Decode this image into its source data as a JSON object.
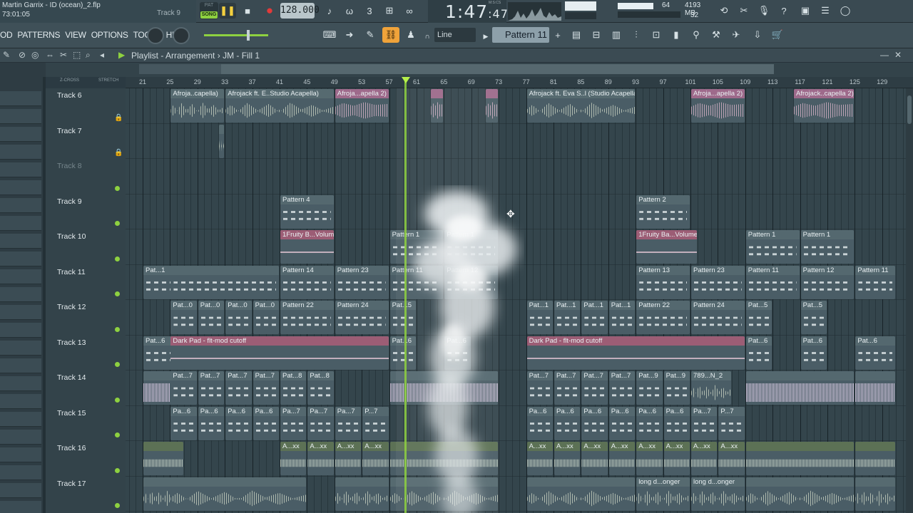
{
  "window": {
    "project_title": "Martin Garrix - ID (ocean)_2.flp",
    "project_time": "73:01:05",
    "track_hint": "Track 9"
  },
  "transport": {
    "pat_label": "PAT",
    "song_label": "SONG",
    "tempo": "128.000",
    "time": "1:47",
    "time_fraction": ":47",
    "time_units": "M:S:CS"
  },
  "system": {
    "cpu": "64",
    "memory": "4193 MB",
    "polyphony": "32"
  },
  "menu": [
    "OD",
    "PATTERNS",
    "VIEW",
    "OPTIONS",
    "TOOLS",
    "HELP"
  ],
  "toolbar": {
    "snap": "Line",
    "pattern": "Pattern 11"
  },
  "playlist": {
    "title": "Playlist - Arrangement",
    "arrangement": "JM - Fill 1",
    "zcross_label": "Z-CROSS",
    "stretch_label": "STRETCH"
  },
  "ruler_ticks": [
    "21",
    "25",
    "29",
    "33",
    "37",
    "41",
    "45",
    "49",
    "53",
    "57",
    "61",
    "65",
    "69",
    "73",
    "77",
    "81",
    "85",
    "89",
    "93",
    "97",
    "101",
    "105",
    "109",
    "113",
    "117",
    "121",
    "125",
    "129"
  ],
  "tracks": [
    {
      "name": "Track 6",
      "locked": true,
      "dim": false
    },
    {
      "name": "Track 7",
      "locked": true,
      "dim": false
    },
    {
      "name": "Track 8",
      "locked": false,
      "dim": true
    },
    {
      "name": "Track 9",
      "locked": false,
      "dim": false
    },
    {
      "name": "Track 10",
      "locked": false,
      "dim": false
    },
    {
      "name": "Track 11",
      "locked": false,
      "dim": false
    },
    {
      "name": "Track 12",
      "locked": false,
      "dim": false
    },
    {
      "name": "Track 13",
      "locked": false,
      "dim": false
    },
    {
      "name": "Track 14",
      "locked": false,
      "dim": false
    },
    {
      "name": "Track 15",
      "locked": false,
      "dim": false
    },
    {
      "name": "Track 16",
      "locked": false,
      "dim": false
    },
    {
      "name": "Track 17",
      "locked": false,
      "dim": false
    }
  ],
  "clips": [
    {
      "track": 0,
      "kind": "audio",
      "label": "Afroja..capella)",
      "start": 25,
      "end": 33
    },
    {
      "track": 0,
      "kind": "audio",
      "label": "Afrojack ft. E..Studio Acapella)",
      "start": 33,
      "end": 49
    },
    {
      "track": 0,
      "kind": "pink",
      "label": "Afroja...apella 2)",
      "start": 49,
      "end": 57
    },
    {
      "track": 0,
      "kind": "pink",
      "label": "",
      "start": 63,
      "end": 65
    },
    {
      "track": 0,
      "kind": "pink",
      "label": "",
      "start": 71,
      "end": 73
    },
    {
      "track": 0,
      "kind": "audio",
      "label": "Afrojack ft. Eva S..l (Studio Acapella)",
      "start": 77,
      "end": 93
    },
    {
      "track": 0,
      "kind": "pink",
      "label": "Afroja...apella 2)",
      "start": 101,
      "end": 109
    },
    {
      "track": 0,
      "kind": "pink",
      "label": "Afrojack..capella 2)",
      "start": 116,
      "end": 125
    },
    {
      "track": 1,
      "kind": "audio",
      "label": "",
      "start": 32,
      "end": 33
    },
    {
      "track": 3,
      "kind": "pattern",
      "label": "Pattern 4",
      "start": 41,
      "end": 49
    },
    {
      "track": 3,
      "kind": "pattern",
      "label": "Pattern 2",
      "start": 93,
      "end": 101
    },
    {
      "track": 4,
      "kind": "automation",
      "label": "1Fruity B...Volume",
      "start": 41,
      "end": 49
    },
    {
      "track": 4,
      "kind": "pattern",
      "label": "Pattern 1",
      "start": 57,
      "end": 65
    },
    {
      "track": 4,
      "kind": "pattern",
      "label": "Pattern 1",
      "start": 65,
      "end": 73
    },
    {
      "track": 4,
      "kind": "automation",
      "label": "1Fruity Ba...Volume",
      "start": 93,
      "end": 102
    },
    {
      "track": 4,
      "kind": "pattern",
      "label": "Pattern 1",
      "start": 109,
      "end": 117
    },
    {
      "track": 4,
      "kind": "pattern",
      "label": "Pattern 1",
      "start": 117,
      "end": 125
    },
    {
      "track": 5,
      "kind": "pattern",
      "label": "Pat...1",
      "start": 21,
      "end": 27
    },
    {
      "track": 5,
      "kind": "pattern",
      "label": "",
      "start": 25,
      "end": 41
    },
    {
      "track": 5,
      "kind": "pattern",
      "label": "Pattern 14",
      "start": 41,
      "end": 49
    },
    {
      "track": 5,
      "kind": "pattern",
      "label": "Pattern 23",
      "start": 49,
      "end": 57
    },
    {
      "track": 5,
      "kind": "pattern",
      "label": "Pattern 11",
      "start": 57,
      "end": 65
    },
    {
      "track": 5,
      "kind": "pattern",
      "label": "Pattern 12",
      "start": 65,
      "end": 73
    },
    {
      "track": 5,
      "kind": "pattern",
      "label": "Pattern 13",
      "start": 93,
      "end": 101
    },
    {
      "track": 5,
      "kind": "pattern",
      "label": "Pattern 23",
      "start": 101,
      "end": 109
    },
    {
      "track": 5,
      "kind": "pattern",
      "label": "Pattern 11",
      "start": 109,
      "end": 117
    },
    {
      "track": 5,
      "kind": "pattern",
      "label": "Pattern 12",
      "start": 117,
      "end": 125
    },
    {
      "track": 5,
      "kind": "pattern",
      "label": "Pattern 11",
      "start": 125,
      "end": 131
    },
    {
      "track": 6,
      "kind": "pattern",
      "label": "Pat...0",
      "start": 25,
      "end": 29
    },
    {
      "track": 6,
      "kind": "pattern",
      "label": "Pat...0",
      "start": 29,
      "end": 33
    },
    {
      "track": 6,
      "kind": "pattern",
      "label": "Pat...0",
      "start": 33,
      "end": 37
    },
    {
      "track": 6,
      "kind": "pattern",
      "label": "Pat...0",
      "start": 37,
      "end": 41
    },
    {
      "track": 6,
      "kind": "pattern",
      "label": "Pattern 22",
      "start": 41,
      "end": 49
    },
    {
      "track": 6,
      "kind": "pattern",
      "label": "Pattern 24",
      "start": 49,
      "end": 57
    },
    {
      "track": 6,
      "kind": "pattern",
      "label": "Pat...5",
      "start": 57,
      "end": 61
    },
    {
      "track": 6,
      "kind": "pattern",
      "label": "Pat...1",
      "start": 77,
      "end": 81
    },
    {
      "track": 6,
      "kind": "pattern",
      "label": "Pat...1",
      "start": 81,
      "end": 85
    },
    {
      "track": 6,
      "kind": "pattern",
      "label": "Pat...1",
      "start": 85,
      "end": 89
    },
    {
      "track": 6,
      "kind": "pattern",
      "label": "Pat...1",
      "start": 89,
      "end": 93
    },
    {
      "track": 6,
      "kind": "pattern",
      "label": "Pattern 22",
      "start": 93,
      "end": 101
    },
    {
      "track": 6,
      "kind": "pattern",
      "label": "Pattern 24",
      "start": 101,
      "end": 109
    },
    {
      "track": 6,
      "kind": "pattern",
      "label": "Pat...5",
      "start": 109,
      "end": 113
    },
    {
      "track": 6,
      "kind": "pattern",
      "label": "Pat...5",
      "start": 117,
      "end": 121
    },
    {
      "track": 7,
      "kind": "pattern",
      "label": "Pat...6",
      "start": 21,
      "end": 27
    },
    {
      "track": 7,
      "kind": "automation",
      "label": "Dark Pad - flt-mod cutoff",
      "start": 25,
      "end": 57
    },
    {
      "track": 7,
      "kind": "pattern",
      "label": "Pat...6",
      "start": 57,
      "end": 61
    },
    {
      "track": 7,
      "kind": "pattern",
      "label": "Pat...6",
      "start": 65,
      "end": 69
    },
    {
      "track": 7,
      "kind": "automation",
      "label": "Dark Pad - flt-mod cutoff",
      "start": 77,
      "end": 109
    },
    {
      "track": 7,
      "kind": "pattern",
      "label": "Pat...6",
      "start": 109,
      "end": 113
    },
    {
      "track": 7,
      "kind": "pattern",
      "label": "Pat...6",
      "start": 117,
      "end": 121
    },
    {
      "track": 7,
      "kind": "pattern",
      "label": "Pat...6",
      "start": 125,
      "end": 131
    },
    {
      "track": 8,
      "kind": "purple",
      "label": "",
      "start": 21,
      "end": 27
    },
    {
      "track": 8,
      "kind": "pattern",
      "label": "Pat...7",
      "start": 25,
      "end": 29
    },
    {
      "track": 8,
      "kind": "pattern",
      "label": "Pat...7",
      "start": 29,
      "end": 33
    },
    {
      "track": 8,
      "kind": "pattern",
      "label": "Pat...7",
      "start": 33,
      "end": 37
    },
    {
      "track": 8,
      "kind": "pattern",
      "label": "Pat...7",
      "start": 37,
      "end": 41
    },
    {
      "track": 8,
      "kind": "pattern",
      "label": "Pat...8",
      "start": 41,
      "end": 45
    },
    {
      "track": 8,
      "kind": "pattern",
      "label": "Pat...8",
      "start": 45,
      "end": 49
    },
    {
      "track": 8,
      "kind": "purple",
      "label": "",
      "start": 57,
      "end": 73
    },
    {
      "track": 8,
      "kind": "pattern",
      "label": "Pat...7",
      "start": 77,
      "end": 81
    },
    {
      "track": 8,
      "kind": "pattern",
      "label": "Pat...7",
      "start": 81,
      "end": 85
    },
    {
      "track": 8,
      "kind": "pattern",
      "label": "Pat...7",
      "start": 85,
      "end": 89
    },
    {
      "track": 8,
      "kind": "pattern",
      "label": "Pat...7",
      "start": 89,
      "end": 93
    },
    {
      "track": 8,
      "kind": "pattern",
      "label": "Pat...9",
      "start": 93,
      "end": 97
    },
    {
      "track": 8,
      "kind": "pattern",
      "label": "Pat...9",
      "start": 97,
      "end": 101
    },
    {
      "track": 8,
      "kind": "audio",
      "label": "789...N_2",
      "start": 101,
      "end": 107
    },
    {
      "track": 8,
      "kind": "purple",
      "label": "",
      "start": 109,
      "end": 125
    },
    {
      "track": 8,
      "kind": "purple",
      "label": "",
      "start": 125,
      "end": 131
    },
    {
      "track": 9,
      "kind": "pattern",
      "label": "Pa...6",
      "start": 25,
      "end": 29
    },
    {
      "track": 9,
      "kind": "pattern",
      "label": "Pa...6",
      "start": 29,
      "end": 33
    },
    {
      "track": 9,
      "kind": "pattern",
      "label": "Pa...6",
      "start": 33,
      "end": 37
    },
    {
      "track": 9,
      "kind": "pattern",
      "label": "Pa...6",
      "start": 37,
      "end": 41
    },
    {
      "track": 9,
      "kind": "pattern",
      "label": "Pa...7",
      "start": 41,
      "end": 45
    },
    {
      "track": 9,
      "kind": "pattern",
      "label": "Pa...7",
      "start": 45,
      "end": 49
    },
    {
      "track": 9,
      "kind": "pattern",
      "label": "Pa...7",
      "start": 49,
      "end": 53
    },
    {
      "track": 9,
      "kind": "pattern",
      "label": "P...7",
      "start": 53,
      "end": 57
    },
    {
      "track": 9,
      "kind": "pattern",
      "label": "Pa...6",
      "start": 77,
      "end": 81
    },
    {
      "track": 9,
      "kind": "pattern",
      "label": "Pa...6",
      "start": 81,
      "end": 85
    },
    {
      "track": 9,
      "kind": "pattern",
      "label": "Pa...6",
      "start": 85,
      "end": 89
    },
    {
      "track": 9,
      "kind": "pattern",
      "label": "Pa...6",
      "start": 89,
      "end": 93
    },
    {
      "track": 9,
      "kind": "pattern",
      "label": "Pa...6",
      "start": 93,
      "end": 97
    },
    {
      "track": 9,
      "kind": "pattern",
      "label": "Pa...6",
      "start": 97,
      "end": 101
    },
    {
      "track": 9,
      "kind": "pattern",
      "label": "Pa...7",
      "start": 101,
      "end": 105
    },
    {
      "track": 9,
      "kind": "pattern",
      "label": "P...7",
      "start": 105,
      "end": 109
    },
    {
      "track": 10,
      "kind": "green",
      "label": "",
      "start": 21,
      "end": 27
    },
    {
      "track": 10,
      "kind": "green",
      "label": "A...xx",
      "start": 41,
      "end": 45
    },
    {
      "track": 10,
      "kind": "green",
      "label": "A...xx",
      "start": 45,
      "end": 49
    },
    {
      "track": 10,
      "kind": "green",
      "label": "A...xx",
      "start": 49,
      "end": 53
    },
    {
      "track": 10,
      "kind": "green",
      "label": "A...xx",
      "start": 53,
      "end": 57
    },
    {
      "track": 10,
      "kind": "green",
      "label": "",
      "start": 57,
      "end": 73
    },
    {
      "track": 10,
      "kind": "green",
      "label": "A...xx",
      "start": 77,
      "end": 81
    },
    {
      "track": 10,
      "kind": "green",
      "label": "A...xx",
      "start": 81,
      "end": 85
    },
    {
      "track": 10,
      "kind": "green",
      "label": "A...xx",
      "start": 85,
      "end": 89
    },
    {
      "track": 10,
      "kind": "green",
      "label": "A...xx",
      "start": 89,
      "end": 93
    },
    {
      "track": 10,
      "kind": "green",
      "label": "A...xx",
      "start": 93,
      "end": 97
    },
    {
      "track": 10,
      "kind": "green",
      "label": "A...xx",
      "start": 97,
      "end": 101
    },
    {
      "track": 10,
      "kind": "green",
      "label": "A...xx",
      "start": 101,
      "end": 105
    },
    {
      "track": 10,
      "kind": "green",
      "label": "A...xx",
      "start": 105,
      "end": 109
    },
    {
      "track": 10,
      "kind": "green",
      "label": "",
      "start": 109,
      "end": 125
    },
    {
      "track": 10,
      "kind": "green",
      "label": "",
      "start": 125,
      "end": 131
    },
    {
      "track": 11,
      "kind": "audio",
      "label": "",
      "start": 21,
      "end": 27
    },
    {
      "track": 11,
      "kind": "audio",
      "label": "",
      "start": 25,
      "end": 45
    },
    {
      "track": 11,
      "kind": "audio",
      "label": "",
      "start": 49,
      "end": 57
    },
    {
      "track": 11,
      "kind": "audio",
      "label": "",
      "start": 57,
      "end": 73
    },
    {
      "track": 11,
      "kind": "audio",
      "label": "",
      "start": 77,
      "end": 93
    },
    {
      "track": 11,
      "kind": "audio",
      "label": "long d...onger",
      "start": 93,
      "end": 101
    },
    {
      "track": 11,
      "kind": "audio",
      "label": "long d...onger",
      "start": 101,
      "end": 109
    },
    {
      "track": 11,
      "kind": "audio",
      "label": "",
      "start": 109,
      "end": 125
    },
    {
      "track": 11,
      "kind": "audio",
      "label": "",
      "start": 125,
      "end": 131
    }
  ]
}
